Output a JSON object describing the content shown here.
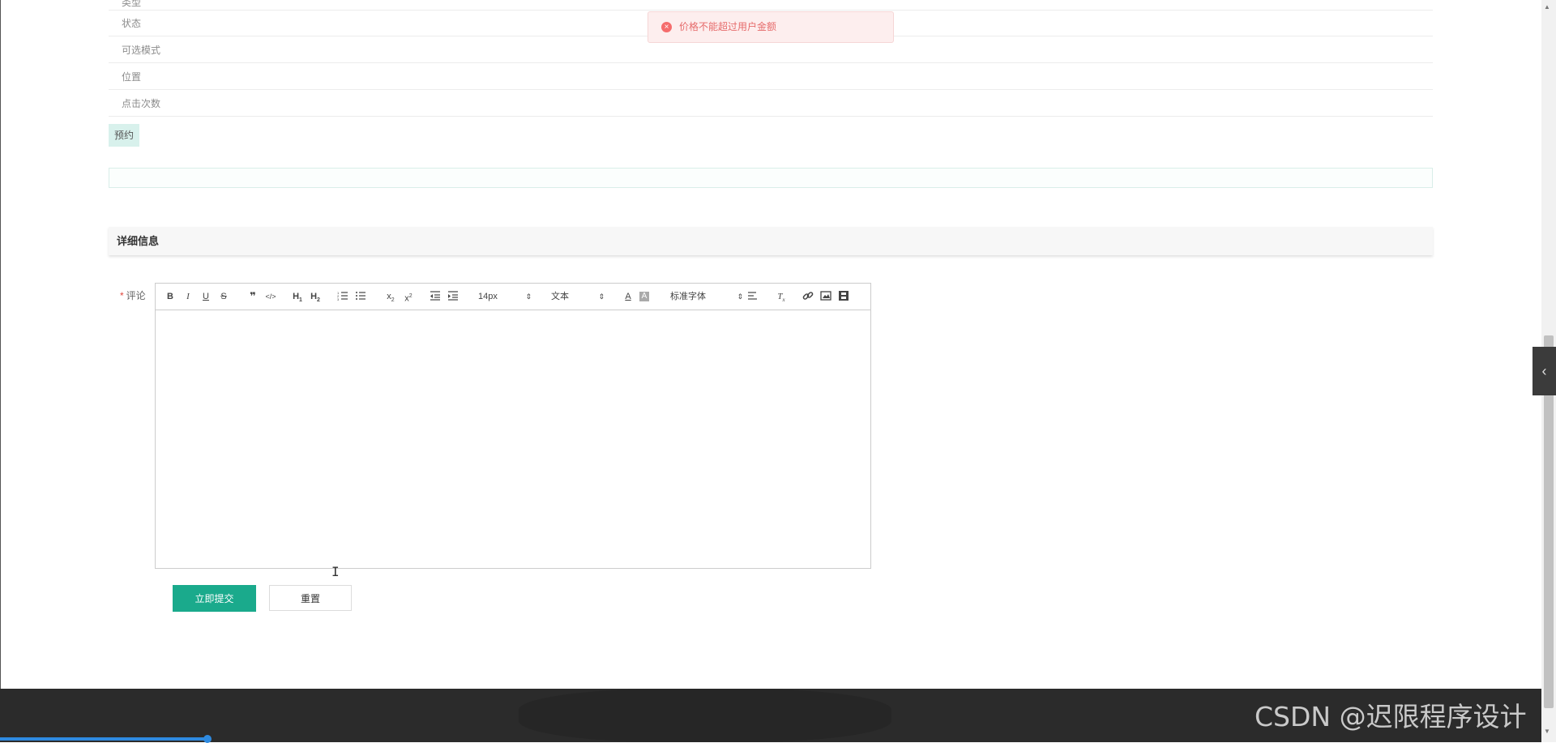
{
  "attributes": {
    "cut_label": "类型",
    "rows": [
      "状态",
      "可选模式",
      "位置",
      "点击次数"
    ]
  },
  "reserve_button": "预约",
  "section_title": "详细信息",
  "comment": {
    "required_mark": "*",
    "label": "评论"
  },
  "editor_toolbar": {
    "font_size": "14px",
    "header_select": "文本",
    "font_family": "标准字体"
  },
  "buttons": {
    "submit": "立即提交",
    "reset": "重置"
  },
  "toast": {
    "message": "价格不能超过用户金额"
  },
  "watermark": "CSDN @迟限程序设计",
  "colors": {
    "primary": "#1aaa8c",
    "error": "#f56c6c",
    "footer": "#2b2b2b"
  }
}
